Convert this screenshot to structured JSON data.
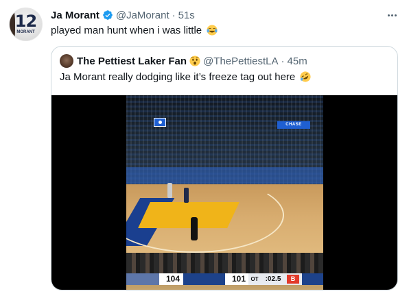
{
  "tweet": {
    "author_name": "Ja Morant",
    "handle": "@JaMorant",
    "separator": "·",
    "time": "51s",
    "text": "played man hunt when i was little",
    "avatar_jersey_number": "12",
    "avatar_jersey_name": "MORANT",
    "text_emoji": "face-with-tears-of-joy-icon"
  },
  "quote": {
    "author_name": "The Pettiest Laker Fan",
    "name_emoji": "hushed-face-icon",
    "handle": "@ThePettiestLA",
    "separator": "·",
    "time": "45m",
    "text": "Ja Morant really dodging like it’s freeze tag out here",
    "text_emoji": "rolling-on-floor-laughing-icon"
  },
  "video": {
    "banner_text": "CHASE",
    "scoreboard": {
      "away_score": "104",
      "home_score": "101",
      "period": "OT",
      "clock": ":02.5",
      "sponsor_mark": "B"
    }
  },
  "colors": {
    "verified_blue": "#1d9bf0",
    "secondary_text": "#536471",
    "border": "#cfd9de"
  }
}
